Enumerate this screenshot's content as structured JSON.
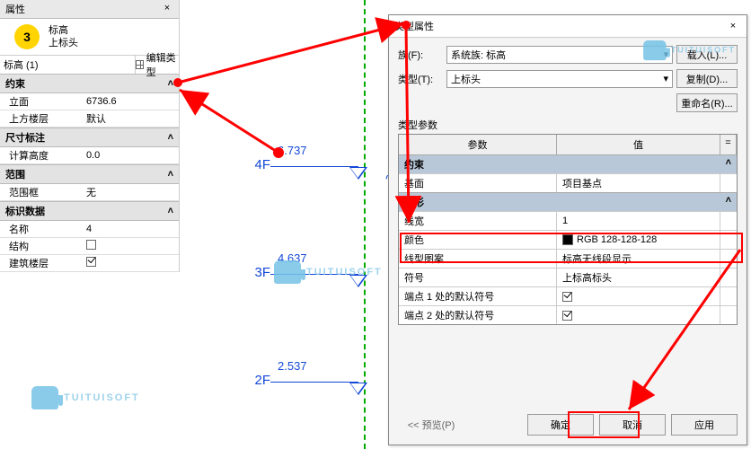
{
  "prop_panel": {
    "title": "属性",
    "badge": "3",
    "head_line1": "标高",
    "head_line2": "上标头",
    "type_selector": "标高 (1)",
    "edit_type": "编辑类型",
    "sections": {
      "constraint": {
        "label": "约束",
        "rows": {
          "elev": {
            "label": "立面",
            "val": "6736.6"
          },
          "upper": {
            "label": "上方楼层",
            "val": "默认"
          }
        }
      },
      "dim": {
        "label": "尺寸标注",
        "rows": {
          "calc": {
            "label": "计算高度",
            "val": "0.0"
          }
        }
      },
      "scope": {
        "label": "范围",
        "rows": {
          "box": {
            "label": "范围框",
            "val": "无"
          }
        }
      },
      "id": {
        "label": "标识数据",
        "rows": {
          "name": {
            "label": "名称",
            "val": "4"
          },
          "struct": {
            "label": "结构"
          },
          "bldg": {
            "label": "建筑楼层"
          }
        }
      }
    }
  },
  "levels": {
    "l4": {
      "name": "4F",
      "elev": "6.737"
    },
    "l3": {
      "name": "3F",
      "elev": "4.637"
    },
    "l2": {
      "name": "2F",
      "elev": "2.537"
    }
  },
  "watermark": "TUITUISOFT",
  "dialog": {
    "title": "类型属性",
    "family_lbl": "族(F):",
    "family_val": "系统族: 标高",
    "type_lbl": "类型(T):",
    "type_val": "上标头",
    "btn_load": "载入(L)...",
    "btn_dup": "复制(D)...",
    "btn_ren": "重命名(R)...",
    "params_lbl": "类型参数",
    "hdr_param": "参数",
    "hdr_val": "值",
    "hdr_eq": "=",
    "cat_constraint": "约束",
    "row_base": {
      "label": "基面",
      "val": "项目基点"
    },
    "cat_graphic": "图形",
    "row_lw": {
      "label": "线宽",
      "val": "1"
    },
    "row_color": {
      "label": "颜色",
      "val": "RGB 128-128-128"
    },
    "row_pattern": {
      "label": "线型图案",
      "val": "标高无线段显示"
    },
    "row_symbol": {
      "label": "符号",
      "val": "上标高标头"
    },
    "row_e1": {
      "label": "端点 1 处的默认符号"
    },
    "row_e2": {
      "label": "端点 2 处的默认符号"
    },
    "foot_prev": "<< 预览(P)",
    "foot_ok": "确定",
    "foot_cancel": "取消",
    "foot_apply": "应用"
  }
}
